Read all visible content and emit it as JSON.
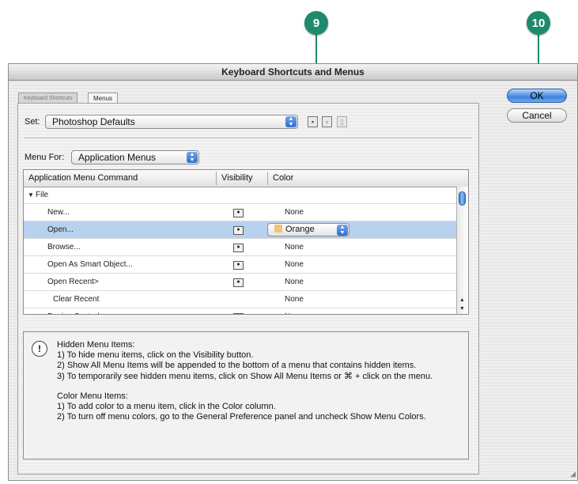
{
  "callouts": {
    "left": "9",
    "right": "10"
  },
  "dialog": {
    "title": "Keyboard Shortcuts and Menus"
  },
  "tabs": [
    {
      "label": "Keyboard Shortcuts"
    },
    {
      "label": "Menus"
    }
  ],
  "set": {
    "label": "Set:",
    "value": "Photoshop Defaults"
  },
  "menu_for": {
    "label": "Menu For:",
    "value": "Application Menus"
  },
  "table": {
    "headers": [
      "Application Menu Command",
      "Visibility",
      "Color"
    ],
    "group": "File",
    "rows": [
      {
        "command": "New...",
        "visible": true,
        "color": "None"
      },
      {
        "command": "Open...",
        "visible": true,
        "color": "Orange",
        "selected": true
      },
      {
        "command": "Browse...",
        "visible": true,
        "color": "None"
      },
      {
        "command": "Open As Smart Object...",
        "visible": true,
        "color": "None"
      },
      {
        "command": "Open Recent>",
        "visible": true,
        "color": "None"
      },
      {
        "command": "Clear Recent",
        "visible": false,
        "color": "None"
      },
      {
        "command": "Device Central...",
        "visible": true,
        "color": "None"
      }
    ]
  },
  "info": {
    "hidden_title": "Hidden Menu Items:",
    "hidden_1": "1) To hide menu items, click on the Visibility button.",
    "hidden_2": "2) Show All Menu Items will be appended to the bottom of a menu that contains hidden items.",
    "hidden_3": "3) To temporarily see hidden menu items, click on Show All Menu Items or ⌘ + click on the menu.",
    "color_title": "Color Menu Items:",
    "color_1": "1) To add color to a menu item, click in the Color column.",
    "color_2": "2) To turn off menu colors, go to the General Preference panel and uncheck Show Menu Colors."
  },
  "buttons": {
    "ok": "OK",
    "cancel": "Cancel"
  },
  "colors": {
    "accent": "#3e84e1",
    "callout": "#1f8a6b",
    "selected_row": "#b7d1ee",
    "orange_swatch": "#f5c07a"
  }
}
